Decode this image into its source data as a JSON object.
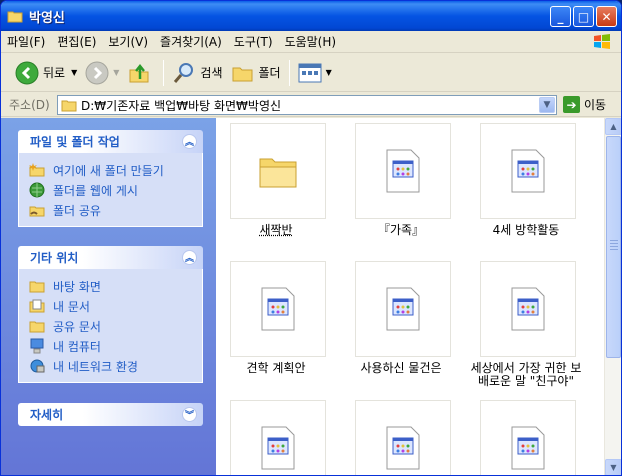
{
  "window": {
    "title": "박영신"
  },
  "menu": [
    "파일(F)",
    "편집(E)",
    "보기(V)",
    "즐겨찾기(A)",
    "도구(T)",
    "도움말(H)"
  ],
  "toolbar": {
    "back": "뒤로",
    "search": "검색",
    "folders": "폴더"
  },
  "address": {
    "label": "주소(D)",
    "path": "D:₩기존자료 백업₩바탕 화면₩박영신",
    "go": "이동"
  },
  "tasks": {
    "file_folder": {
      "title": "파일 및 폴더 작업",
      "items": [
        "여기에 새 폴더 만들기",
        "폴더를 웹에 게시",
        "폴더 공유"
      ]
    },
    "other_places": {
      "title": "기타 위치",
      "items": [
        "바탕 화면",
        "내 문서",
        "공유 문서",
        "내 컴퓨터",
        "내 네트워크 환경"
      ]
    },
    "details": {
      "title": "자세히"
    }
  },
  "files": [
    {
      "name": "새짝반",
      "type": "folder"
    },
    {
      "name": "『가족』",
      "type": "doc"
    },
    {
      "name": "4세 방학활동",
      "type": "doc"
    },
    {
      "name": "견학 계획안",
      "type": "doc"
    },
    {
      "name": "사용하신 물건은",
      "type": "doc"
    },
    {
      "name": "세상에서 가장 귀한 보배로운 말 \"친구야\"",
      "type": "doc"
    },
    {
      "name": "",
      "type": "doc"
    },
    {
      "name": "",
      "type": "doc"
    },
    {
      "name": "",
      "type": "doc"
    }
  ],
  "colors": {
    "titlebar": "#0054E3",
    "taskpane": "#7BA2E7",
    "link": "#215DC6"
  }
}
